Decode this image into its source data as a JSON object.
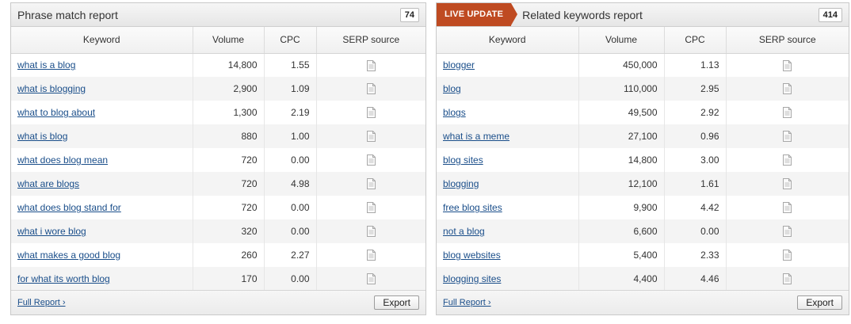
{
  "left": {
    "title": "Phrase match report",
    "count": "74",
    "columns": {
      "keyword": "Keyword",
      "volume": "Volume",
      "cpc": "CPC",
      "serp": "SERP source"
    },
    "rows": [
      {
        "keyword": "what is a blog",
        "volume": "14,800",
        "cpc": "1.55"
      },
      {
        "keyword": "what is blogging",
        "volume": "2,900",
        "cpc": "1.09"
      },
      {
        "keyword": "what to blog about",
        "volume": "1,300",
        "cpc": "2.19"
      },
      {
        "keyword": "what is blog",
        "volume": "880",
        "cpc": "1.00"
      },
      {
        "keyword": "what does blog mean",
        "volume": "720",
        "cpc": "0.00"
      },
      {
        "keyword": "what are blogs",
        "volume": "720",
        "cpc": "4.98"
      },
      {
        "keyword": "what does blog stand for",
        "volume": "720",
        "cpc": "0.00"
      },
      {
        "keyword": "what i wore blog",
        "volume": "320",
        "cpc": "0.00"
      },
      {
        "keyword": "what makes a good blog",
        "volume": "260",
        "cpc": "2.27"
      },
      {
        "keyword": "for what its worth blog",
        "volume": "170",
        "cpc": "0.00"
      }
    ],
    "footer": {
      "full_report": "Full Report ›",
      "export": "Export"
    }
  },
  "right": {
    "badge": "LIVE UPDATE",
    "title": "Related keywords report",
    "count": "414",
    "columns": {
      "keyword": "Keyword",
      "volume": "Volume",
      "cpc": "CPC",
      "serp": "SERP source"
    },
    "rows": [
      {
        "keyword": "blogger",
        "volume": "450,000",
        "cpc": "1.13"
      },
      {
        "keyword": "blog",
        "volume": "110,000",
        "cpc": "2.95"
      },
      {
        "keyword": "blogs",
        "volume": "49,500",
        "cpc": "2.92"
      },
      {
        "keyword": "what is a meme",
        "volume": "27,100",
        "cpc": "0.96"
      },
      {
        "keyword": "blog sites",
        "volume": "14,800",
        "cpc": "3.00"
      },
      {
        "keyword": "blogging",
        "volume": "12,100",
        "cpc": "1.61"
      },
      {
        "keyword": "free blog sites",
        "volume": "9,900",
        "cpc": "4.42"
      },
      {
        "keyword": "not a blog",
        "volume": "6,600",
        "cpc": "0.00"
      },
      {
        "keyword": "blog websites",
        "volume": "5,400",
        "cpc": "2.33"
      },
      {
        "keyword": "blogging sites",
        "volume": "4,400",
        "cpc": "4.46"
      }
    ],
    "footer": {
      "full_report": "Full Report ›",
      "export": "Export"
    }
  },
  "icons": {
    "serp_source": "document-icon"
  },
  "colors": {
    "live_badge": "#bf4b22",
    "link": "#1a4e8a"
  }
}
